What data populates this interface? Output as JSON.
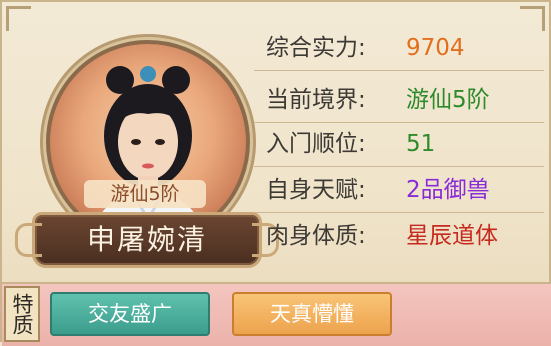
{
  "character": {
    "name": "申屠婉清",
    "realm_tag": "游仙5阶"
  },
  "stats": [
    {
      "label": "综合实力:",
      "value": "9704",
      "color": "#e36f1e"
    },
    {
      "label": "当前境界:",
      "value": "游仙5阶",
      "color": "#2f8a2c"
    },
    {
      "label": "入门顺位:",
      "value": "51",
      "color": "#2f8a2c"
    },
    {
      "label": "自身天赋:",
      "value": "2品御兽",
      "color": "#8a2bd8"
    },
    {
      "label": "肉身体质:",
      "value": "星辰道体",
      "color": "#c62a1e"
    }
  ],
  "traits": {
    "label": "特质",
    "items": [
      "交友盛广",
      "天真懵懂"
    ]
  }
}
